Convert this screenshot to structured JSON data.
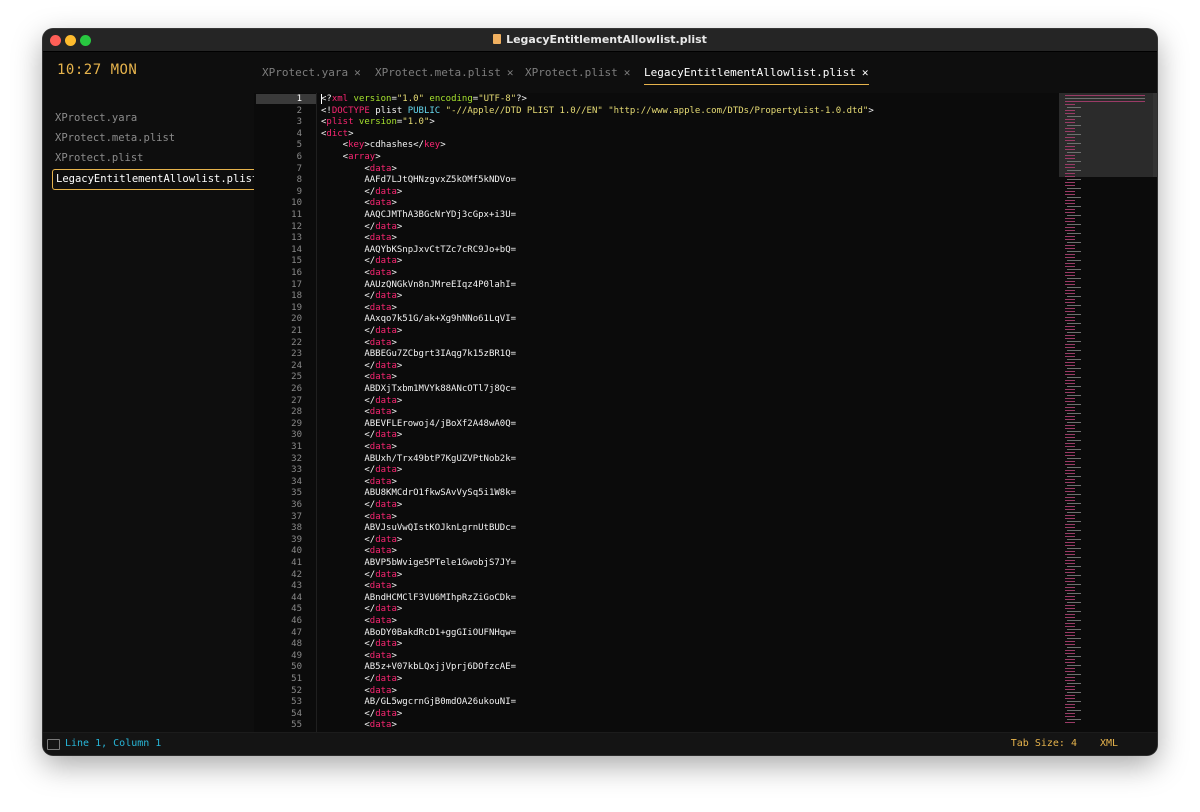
{
  "window": {
    "title": "LegacyEntitlementAllowlist.plist"
  },
  "sidebar": {
    "clock": "10:27 MON",
    "files": [
      {
        "label": "XProtect.yara",
        "active": false
      },
      {
        "label": "XProtect.meta.plist",
        "active": false
      },
      {
        "label": "XProtect.plist",
        "active": false
      },
      {
        "label": "LegacyEntitlementAllowlist.plist",
        "active": true
      }
    ]
  },
  "tabs": [
    {
      "label": "XProtect.yara",
      "active": false
    },
    {
      "label": "XProtect.meta.plist",
      "active": false
    },
    {
      "label": "XProtect.plist",
      "active": false
    },
    {
      "label": "LegacyEntitlementAllowlist.plist",
      "active": true
    }
  ],
  "editor": {
    "current_line": 1,
    "lines": [
      [
        [
          "tx",
          "<?"
        ],
        [
          "tg",
          "xml"
        ],
        [
          "at",
          " version"
        ],
        [
          "tx",
          "="
        ],
        [
          "sv",
          "\"1.0\""
        ],
        [
          "at",
          " encoding"
        ],
        [
          "tx",
          "="
        ],
        [
          "sv",
          "\"UTF-8\""
        ],
        [
          "tx",
          "?>"
        ]
      ],
      [
        [
          "tx",
          "<!"
        ],
        [
          "tg",
          "DOCTYPE"
        ],
        [
          "tx",
          " plist "
        ],
        [
          "kw",
          "PUBLIC"
        ],
        [
          "tx",
          " "
        ],
        [
          "sv",
          "\"-//Apple//DTD PLIST 1.0//EN\""
        ],
        [
          "tx",
          " "
        ],
        [
          "sv",
          "\"http://www.apple.com/DTDs/PropertyList-1.0.dtd\""
        ],
        [
          "tx",
          ">"
        ]
      ],
      [
        [
          "tx",
          "<"
        ],
        [
          "tg",
          "plist"
        ],
        [
          "at",
          " version"
        ],
        [
          "tx",
          "="
        ],
        [
          "sv",
          "\"1.0\""
        ],
        [
          "tx",
          ">"
        ]
      ],
      [
        [
          "tx",
          "<"
        ],
        [
          "tg",
          "dict"
        ],
        [
          "tx",
          ">"
        ]
      ],
      [
        [
          "tx",
          "    <"
        ],
        [
          "tg",
          "key"
        ],
        [
          "tx",
          ">cdhashes</"
        ],
        [
          "tg",
          "key"
        ],
        [
          "tx",
          ">"
        ]
      ],
      [
        [
          "tx",
          "    <"
        ],
        [
          "tg",
          "array"
        ],
        [
          "tx",
          ">"
        ]
      ],
      [
        [
          "tx",
          "        <"
        ],
        [
          "tg",
          "data"
        ],
        [
          "tx",
          ">"
        ]
      ],
      [
        [
          "tx",
          "        AAFd7LJtQHNzgvxZ5kOMf5kNDVo="
        ]
      ],
      [
        [
          "tx",
          "        </"
        ],
        [
          "tg",
          "data"
        ],
        [
          "tx",
          ">"
        ]
      ],
      [
        [
          "tx",
          "        <"
        ],
        [
          "tg",
          "data"
        ],
        [
          "tx",
          ">"
        ]
      ],
      [
        [
          "tx",
          "        AAQCJMThA3BGcNrYDj3cGpx+i3U="
        ]
      ],
      [
        [
          "tx",
          "        </"
        ],
        [
          "tg",
          "data"
        ],
        [
          "tx",
          ">"
        ]
      ],
      [
        [
          "tx",
          "        <"
        ],
        [
          "tg",
          "data"
        ],
        [
          "tx",
          ">"
        ]
      ],
      [
        [
          "tx",
          "        AAQYbKSnpJxvCtTZc7cRC9Jo+bQ="
        ]
      ],
      [
        [
          "tx",
          "        </"
        ],
        [
          "tg",
          "data"
        ],
        [
          "tx",
          ">"
        ]
      ],
      [
        [
          "tx",
          "        <"
        ],
        [
          "tg",
          "data"
        ],
        [
          "tx",
          ">"
        ]
      ],
      [
        [
          "tx",
          "        AAUzQNGkVn8nJMreEIqz4P0lahI="
        ]
      ],
      [
        [
          "tx",
          "        </"
        ],
        [
          "tg",
          "data"
        ],
        [
          "tx",
          ">"
        ]
      ],
      [
        [
          "tx",
          "        <"
        ],
        [
          "tg",
          "data"
        ],
        [
          "tx",
          ">"
        ]
      ],
      [
        [
          "tx",
          "        AAxqo7k51G/ak+Xg9hNNo61LqVI="
        ]
      ],
      [
        [
          "tx",
          "        </"
        ],
        [
          "tg",
          "data"
        ],
        [
          "tx",
          ">"
        ]
      ],
      [
        [
          "tx",
          "        <"
        ],
        [
          "tg",
          "data"
        ],
        [
          "tx",
          ">"
        ]
      ],
      [
        [
          "tx",
          "        ABBEGu7ZCbgrt3IAqg7k15zBR1Q="
        ]
      ],
      [
        [
          "tx",
          "        </"
        ],
        [
          "tg",
          "data"
        ],
        [
          "tx",
          ">"
        ]
      ],
      [
        [
          "tx",
          "        <"
        ],
        [
          "tg",
          "data"
        ],
        [
          "tx",
          ">"
        ]
      ],
      [
        [
          "tx",
          "        ABDXjTxbm1MVYk88ANcOTl7j8Qc="
        ]
      ],
      [
        [
          "tx",
          "        </"
        ],
        [
          "tg",
          "data"
        ],
        [
          "tx",
          ">"
        ]
      ],
      [
        [
          "tx",
          "        <"
        ],
        [
          "tg",
          "data"
        ],
        [
          "tx",
          ">"
        ]
      ],
      [
        [
          "tx",
          "        ABEVFLErowoj4/jBoXf2A48wA0Q="
        ]
      ],
      [
        [
          "tx",
          "        </"
        ],
        [
          "tg",
          "data"
        ],
        [
          "tx",
          ">"
        ]
      ],
      [
        [
          "tx",
          "        <"
        ],
        [
          "tg",
          "data"
        ],
        [
          "tx",
          ">"
        ]
      ],
      [
        [
          "tx",
          "        ABUxh/Trx49btP7KgUZVPtNob2k="
        ]
      ],
      [
        [
          "tx",
          "        </"
        ],
        [
          "tg",
          "data"
        ],
        [
          "tx",
          ">"
        ]
      ],
      [
        [
          "tx",
          "        <"
        ],
        [
          "tg",
          "data"
        ],
        [
          "tx",
          ">"
        ]
      ],
      [
        [
          "tx",
          "        ABU8KMCdrO1fkwSAvVySq5i1W8k="
        ]
      ],
      [
        [
          "tx",
          "        </"
        ],
        [
          "tg",
          "data"
        ],
        [
          "tx",
          ">"
        ]
      ],
      [
        [
          "tx",
          "        <"
        ],
        [
          "tg",
          "data"
        ],
        [
          "tx",
          ">"
        ]
      ],
      [
        [
          "tx",
          "        ABVJsuVwQIstKOJknLgrnUtBUDc="
        ]
      ],
      [
        [
          "tx",
          "        </"
        ],
        [
          "tg",
          "data"
        ],
        [
          "tx",
          ">"
        ]
      ],
      [
        [
          "tx",
          "        <"
        ],
        [
          "tg",
          "data"
        ],
        [
          "tx",
          ">"
        ]
      ],
      [
        [
          "tx",
          "        ABVP5bWvige5PTele1GwobjS7JY="
        ]
      ],
      [
        [
          "tx",
          "        </"
        ],
        [
          "tg",
          "data"
        ],
        [
          "tx",
          ">"
        ]
      ],
      [
        [
          "tx",
          "        <"
        ],
        [
          "tg",
          "data"
        ],
        [
          "tx",
          ">"
        ]
      ],
      [
        [
          "tx",
          "        ABndHCMClF3VU6MIhpRzZiGoCDk="
        ]
      ],
      [
        [
          "tx",
          "        </"
        ],
        [
          "tg",
          "data"
        ],
        [
          "tx",
          ">"
        ]
      ],
      [
        [
          "tx",
          "        <"
        ],
        [
          "tg",
          "data"
        ],
        [
          "tx",
          ">"
        ]
      ],
      [
        [
          "tx",
          "        ABoDY0BakdRcD1+ggGIiOUFNHqw="
        ]
      ],
      [
        [
          "tx",
          "        </"
        ],
        [
          "tg",
          "data"
        ],
        [
          "tx",
          ">"
        ]
      ],
      [
        [
          "tx",
          "        <"
        ],
        [
          "tg",
          "data"
        ],
        [
          "tx",
          ">"
        ]
      ],
      [
        [
          "tx",
          "        AB5z+V07kbLQxjjVprj6DOfzcAE="
        ]
      ],
      [
        [
          "tx",
          "        </"
        ],
        [
          "tg",
          "data"
        ],
        [
          "tx",
          ">"
        ]
      ],
      [
        [
          "tx",
          "        <"
        ],
        [
          "tg",
          "data"
        ],
        [
          "tx",
          ">"
        ]
      ],
      [
        [
          "tx",
          "        AB/GL5wgcrnGjB0mdOA26ukouNI="
        ]
      ],
      [
        [
          "tx",
          "        </"
        ],
        [
          "tg",
          "data"
        ],
        [
          "tx",
          ">"
        ]
      ],
      [
        [
          "tx",
          "        <"
        ],
        [
          "tg",
          "data"
        ],
        [
          "tx",
          ">"
        ]
      ]
    ]
  },
  "status": {
    "position": "Line 1, Column 1",
    "tab_size": "Tab Size: 4",
    "syntax": "XML"
  },
  "colors": {
    "accent": "#e6b34c",
    "tag": "#f92672",
    "attribute": "#a6e22e",
    "string": "#e6db74",
    "keyword": "#66d9ef",
    "status_position": "#28b6d8"
  }
}
